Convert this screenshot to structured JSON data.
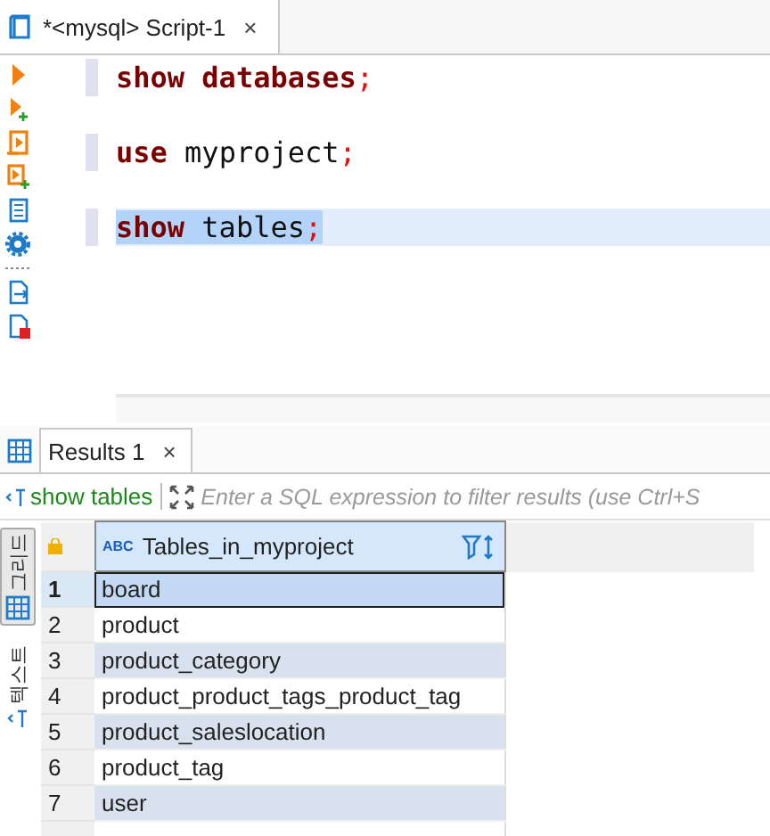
{
  "editor_tab": {
    "title": "*<mysql> Script-1",
    "close": "×"
  },
  "code_lines": [
    {
      "selected": false,
      "tokens": [
        {
          "kind": "keyword",
          "text": "show"
        },
        {
          "kind": "keyword",
          "text": "databases"
        },
        {
          "kind": "punct",
          "text": ";"
        }
      ]
    },
    {
      "selected": false,
      "tokens": [
        {
          "kind": "keyword",
          "text": "use"
        },
        {
          "kind": "plain",
          "text": "myproject"
        },
        {
          "kind": "punct",
          "text": ";"
        }
      ]
    },
    {
      "selected": true,
      "tokens": [
        {
          "kind": "keyword",
          "text": "show"
        },
        {
          "kind": "plain",
          "text": "tables"
        },
        {
          "kind": "punct",
          "text": ";"
        }
      ]
    }
  ],
  "results_tab": {
    "title": "Results 1",
    "close": "×"
  },
  "filter": {
    "query": "show tables",
    "placeholder": "Enter a SQL expression to filter results (use Ctrl+S"
  },
  "view_modes": [
    {
      "label": "그리드",
      "selected": true
    },
    {
      "label": "텍스트",
      "selected": false
    }
  ],
  "table": {
    "columns": [
      "Tables_in_myproject"
    ],
    "type_badge": "ABC",
    "rows": [
      {
        "number": "1",
        "cells": [
          "board"
        ],
        "selected": true
      },
      {
        "number": "2",
        "cells": [
          "product"
        ],
        "selected": false
      },
      {
        "number": "3",
        "cells": [
          "product_category"
        ],
        "selected": false
      },
      {
        "number": "4",
        "cells": [
          "product_product_tags_product_tag"
        ],
        "selected": false
      },
      {
        "number": "5",
        "cells": [
          "product_saleslocation"
        ],
        "selected": false
      },
      {
        "number": "6",
        "cells": [
          "product_tag"
        ],
        "selected": false
      },
      {
        "number": "7",
        "cells": [
          "user"
        ],
        "selected": false
      }
    ]
  }
}
